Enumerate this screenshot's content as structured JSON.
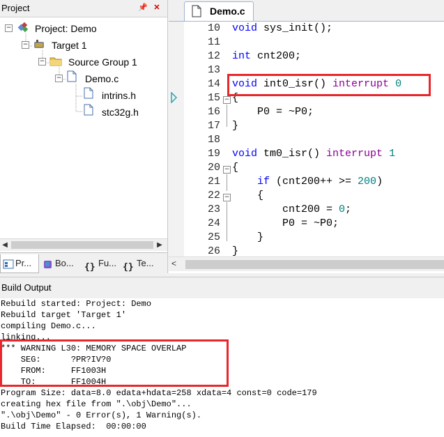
{
  "project_panel": {
    "title": "Project",
    "tree": [
      {
        "label": "Project: Demo",
        "icon": "project-icon"
      },
      {
        "label": "Target 1",
        "icon": "target-icon"
      },
      {
        "label": "Source Group 1",
        "icon": "folder-icon"
      },
      {
        "label": "Demo.c",
        "icon": "file-icon"
      },
      {
        "label": "intrins.h",
        "icon": "file-icon"
      },
      {
        "label": "stc32g.h",
        "icon": "file-icon"
      }
    ],
    "tabs": [
      {
        "label": "Pr...",
        "icon": "project-tab-icon"
      },
      {
        "label": "Bo...",
        "icon": "books-tab-icon"
      },
      {
        "label": "Fu...",
        "icon": "functions-tab-icon"
      },
      {
        "label": "Te...",
        "icon": "templates-tab-icon"
      }
    ]
  },
  "editor": {
    "tab_label": "Demo.c",
    "lines": [
      {
        "n": "10"
      },
      {
        "n": "11"
      },
      {
        "n": "12"
      },
      {
        "n": "13"
      },
      {
        "n": "14"
      },
      {
        "n": "15"
      },
      {
        "n": "16"
      },
      {
        "n": "17"
      },
      {
        "n": "18"
      },
      {
        "n": "19"
      },
      {
        "n": "20"
      },
      {
        "n": "21"
      },
      {
        "n": "22"
      },
      {
        "n": "23"
      },
      {
        "n": "24"
      },
      {
        "n": "25"
      },
      {
        "n": "26"
      }
    ],
    "code": {
      "l10_a": "void",
      "l10_b": " sys_init();",
      "l12_a": "int",
      "l12_b": " cnt200;",
      "l14_a": "void",
      "l14_b": " int0_isr() ",
      "l14_c": "interrupt",
      "l14_d": " 0",
      "l15": "{",
      "l16": "    P0 = ~P0;",
      "l17": "}",
      "l19_a": "void",
      "l19_b": " tm0_isr() ",
      "l19_c": "interrupt",
      "l19_d": " 1",
      "l20": "{",
      "l21_a": "    if",
      "l21_b": " (cnt200++ >= ",
      "l21_c": "200",
      "l21_d": ")",
      "l22": "    {",
      "l23_a": "        cnt200 = ",
      "l23_b": "0",
      "l23_c": ";",
      "l24": "        P0 = ~P0;",
      "l25": "    }",
      "l26": "}"
    }
  },
  "build_output": {
    "title": "Build Output",
    "lines": [
      "Rebuild started: Project: Demo",
      "Rebuild target 'Target 1'",
      "compiling Demo.c...",
      "linking...",
      "*** WARNING L30: MEMORY SPACE OVERLAP",
      "    SEG:      ?PR?IV?0",
      "    FROM:     FF1003H",
      "    TO:       FF1004H",
      "Program Size: data=8.0 edata+hdata=258 xdata=4 const=0 code=179",
      "creating hex file from \".\\obj\\Demo\"...",
      "\".\\obj\\Demo\" - 0 Error(s), 1 Warning(s).",
      "Build Time Elapsed:  00:00:00"
    ]
  },
  "colors": {
    "keyword": "#0000ff",
    "interrupt": "#8a0093",
    "number": "#008080",
    "highlight": "#e8262b"
  }
}
